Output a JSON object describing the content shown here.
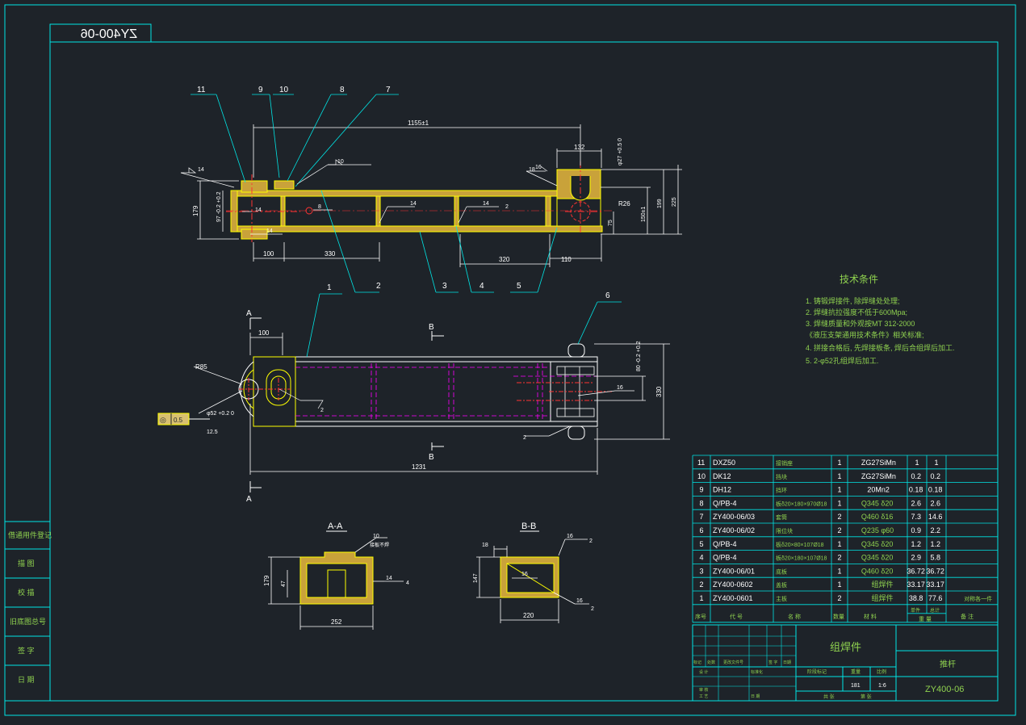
{
  "colors": {
    "background": "#1e2329",
    "frame": "#00e5e5",
    "part_outline": "#ffff00",
    "part_fill": "#c9a23a",
    "hidden_line": "#ff00ff",
    "centerline": "#ff3333",
    "dimension": "#ffffff",
    "text_green": "#8fd14f"
  },
  "drawing_code_mirrored": "ZY400-06",
  "top_view": {
    "balloons": [
      "11",
      "9",
      "10",
      "8",
      "7",
      "2",
      "3",
      "4",
      "5"
    ],
    "dims": {
      "overall": "1155±1",
      "d100": "100",
      "d330": "330",
      "d320": "320",
      "d110": "110",
      "d132": "132",
      "d179": "179",
      "d97": "97 -0.2 +0.2",
      "d150": "150±1",
      "d199": "199",
      "d225": "225",
      "d75": "75",
      "d18": "18",
      "phi27": "φ27 +0.5 0",
      "r26": "R26"
    },
    "welds": [
      "14",
      "10",
      "16",
      "8",
      "14",
      "14",
      "14",
      "2",
      "14"
    ]
  },
  "front_view": {
    "balloons": [
      "1",
      "6"
    ],
    "dims": {
      "d100": "100",
      "overall": "1231",
      "d330": "330",
      "d80": "80 -0.2 +0.2",
      "r85": "R85",
      "phi52": "φ52 +0.2 0",
      "d125": "12.5",
      "d16": "16",
      "d2a": "2",
      "d2b": "2"
    },
    "section_marks": {
      "a": "A",
      "b": "B"
    },
    "tolerance_frame": {
      "symbol": "◎",
      "value": "0.5"
    }
  },
  "sections": {
    "aa": {
      "title": "A-A",
      "dims": {
        "d179": "179",
        "d47": "47",
        "d252": "252"
      },
      "welds": {
        "top": "10",
        "top_note": "接板不焊",
        "side": "14",
        "side_num": "4"
      }
    },
    "bb": {
      "title": "B-B",
      "dims": {
        "d18": "18",
        "d147": "147",
        "d220": "220"
      },
      "welds": {
        "top": "16",
        "top_num": "2",
        "mid": "16",
        "bottom": "16",
        "bottom_num": "2"
      }
    }
  },
  "tech_requirements": {
    "title": "技术条件",
    "items": [
      "1. 铸锻焊接件, 除焊缝处处理;",
      "2. 焊缝抗拉强度不低于600Mpa;",
      "3. 焊缝质量和外观按MT 312-2000",
      "《液压支架通用技术条件》相关标准;",
      "4. 拼接合格后, 先焊接板条, 焊后合组焊后加工.",
      "5. 2-φ52孔组焊后加工."
    ]
  },
  "bom": {
    "rows": [
      {
        "no": "11",
        "code": "DXZ50",
        "name": "接销座",
        "qty": "1",
        "mat": "ZG27SiMn",
        "w1": "1",
        "w2": "1",
        "note": ""
      },
      {
        "no": "10",
        "code": "DK12",
        "name": "挡块",
        "qty": "1",
        "mat": "ZG27SiMn",
        "w1": "0.2",
        "w2": "0.2",
        "note": ""
      },
      {
        "no": "9",
        "code": "DH12",
        "name": "挡环",
        "qty": "1",
        "mat": "20Mn2",
        "w1": "0.18",
        "w2": "0.18",
        "note": ""
      },
      {
        "no": "8",
        "code": "Q/PB-4",
        "name": "板δ20×180×970Ø18",
        "qty": "1",
        "mat": "Q345 δ20",
        "w1": "2.6",
        "w2": "2.6",
        "note": ""
      },
      {
        "no": "7",
        "code": "ZY400-06/03",
        "name": "套筒",
        "qty": "2",
        "mat": "Q460 δ16",
        "w1": "7.3",
        "w2": "14.6",
        "note": ""
      },
      {
        "no": "6",
        "code": "ZY400-06/02",
        "name": "限位块",
        "qty": "2",
        "mat": "Q235 φ60",
        "w1": "0.9",
        "w2": "2.2",
        "note": ""
      },
      {
        "no": "5",
        "code": "Q/PB-4",
        "name": "板δ20×80×107Ø18",
        "qty": "1",
        "mat": "Q345 δ20",
        "w1": "1.2",
        "w2": "1.2",
        "note": ""
      },
      {
        "no": "4",
        "code": "Q/PB-4",
        "name": "板δ20×180×107Ø18",
        "qty": "2",
        "mat": "Q345 δ20",
        "w1": "2.9",
        "w2": "5.8",
        "note": ""
      },
      {
        "no": "3",
        "code": "ZY400-06/01",
        "name": "底板",
        "qty": "1",
        "mat": "Q460 δ20",
        "w1": "36.72",
        "w2": "36.72",
        "note": ""
      },
      {
        "no": "2",
        "code": "ZY400-0602",
        "name": "盖板",
        "qty": "1",
        "mat": "组焊件",
        "w1": "33.17",
        "w2": "33.17",
        "note": ""
      },
      {
        "no": "1",
        "code": "ZY400-0601",
        "name": "主板",
        "qty": "2",
        "mat": "组焊件",
        "w1": "38.8",
        "w2": "77.6",
        "note": "对称各一件"
      }
    ],
    "header": {
      "no": "序号",
      "code": "代 号",
      "name": "名 称",
      "qty": "数量",
      "mat": "材 料",
      "w_single": "单件",
      "w_total": "总计",
      "weight": "重 量",
      "note": "备 注"
    }
  },
  "title_block": {
    "assembly_type": "组焊件",
    "part_name": "推杆",
    "drawing_no": "ZY400-06",
    "weight_label": "重量",
    "scale_label": "比例",
    "weight": "181",
    "scale": "1:6",
    "stage_label": "阶段标记",
    "sheet_total": "共 张",
    "sheet_no": "第 张",
    "rev_labels": [
      "标记",
      "处数",
      "更改文件号",
      "签 字",
      "日期"
    ],
    "role_labels": [
      "设 计",
      "标准化",
      "审 核",
      "工 艺",
      "日 期"
    ]
  },
  "left_stamp": {
    "rows": [
      "借通用件登记",
      "描 图",
      "校 描",
      "旧底图总号",
      "签 字",
      "日 期"
    ]
  }
}
